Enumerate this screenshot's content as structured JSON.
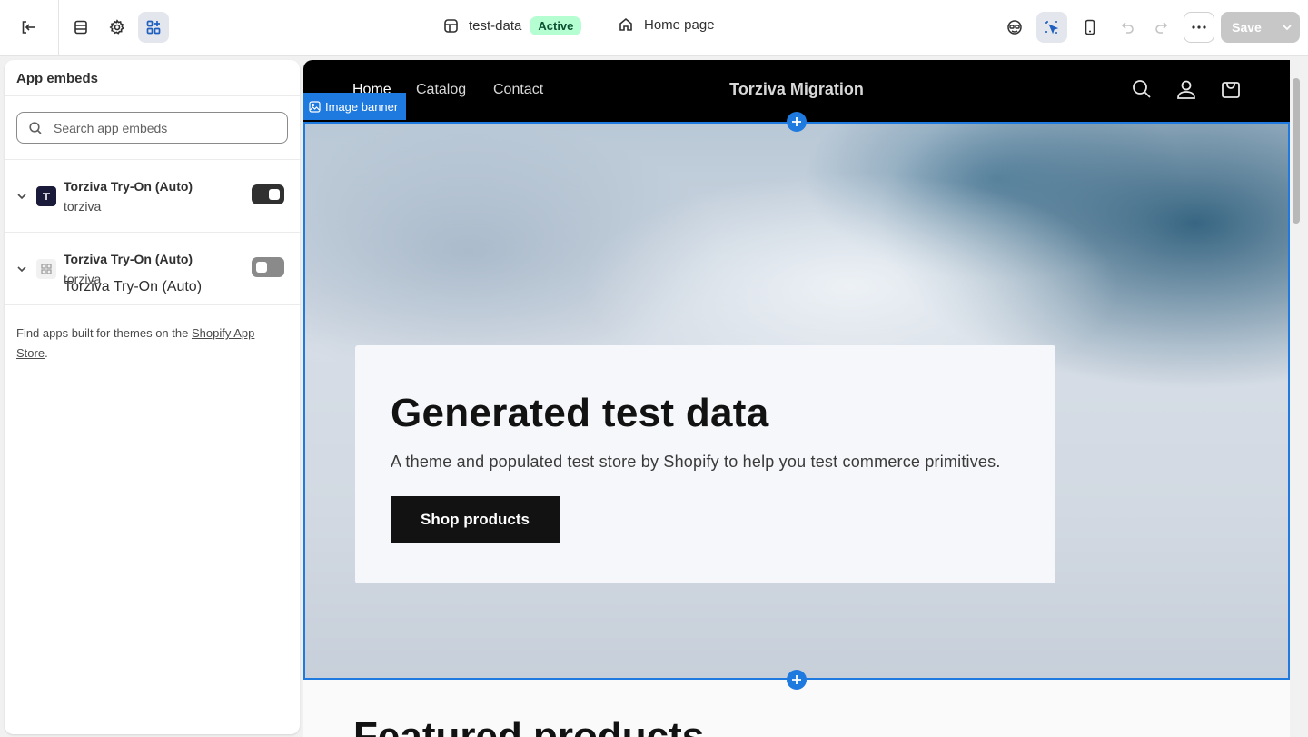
{
  "toolbar": {
    "exit_icon": "exit-icon",
    "sections_icon": "sections-icon",
    "settings_icon": "gear-icon",
    "app_embeds_icon": "apps-icon",
    "theme_name": "test-data",
    "theme_status": "Active",
    "page_name": "Home page",
    "save_label": "Save"
  },
  "sidebar": {
    "title": "App embeds",
    "search_placeholder": "Search app embeds",
    "embeds": [
      {
        "name": "Torziva Try-On (Auto)",
        "sub": "torziva",
        "enabled": true
      },
      {
        "name": "Torziva Try-On (Auto)",
        "sub": "torziva",
        "enabled": false
      }
    ],
    "footer_text": "Find apps built for themes on the ",
    "footer_link": "Shopify App Store",
    "footer_end": "."
  },
  "preview": {
    "nav": [
      "Home",
      "Catalog",
      "Contact"
    ],
    "store_title": "Torziva Migration",
    "section_label": "Image banner",
    "banner_heading": "Generated test data",
    "banner_text": "A theme and populated test store by Shopify to help you test commerce primitives.",
    "banner_button": "Shop products",
    "next_heading": "Featured products"
  },
  "colors": {
    "accent": "#1f7ae0",
    "badge_bg": "#b4fed2",
    "badge_text": "#0c5132",
    "header_bg": "#000000"
  }
}
